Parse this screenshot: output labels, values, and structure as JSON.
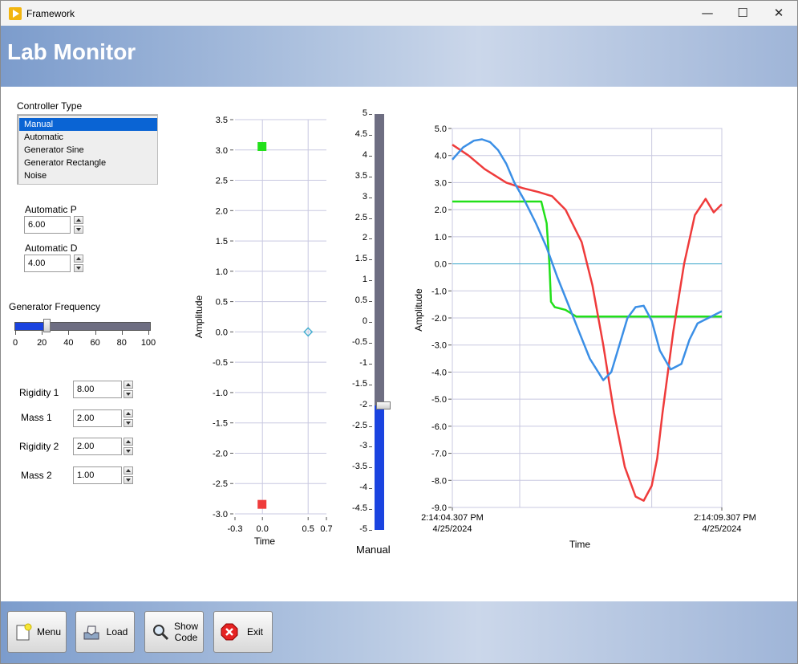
{
  "window": {
    "title": "Framework",
    "minimize": "—",
    "maximize": "☐",
    "close": "✕"
  },
  "header": {
    "title": "Lab Monitor"
  },
  "controller": {
    "label": "Controller Type",
    "items": [
      "Manual",
      "Automatic",
      "Generator Sine",
      "Generator Rectangle",
      "Noise"
    ],
    "selected": "Manual"
  },
  "automatic_p": {
    "label": "Automatic P",
    "value": "6.00"
  },
  "automatic_d": {
    "label": "Automatic D",
    "value": "4.00"
  },
  "generator_frequency": {
    "label": "Generator Frequency",
    "value": 23,
    "ticks": [
      "0",
      "20",
      "40",
      "60",
      "80",
      "100"
    ]
  },
  "rigidity_1": {
    "label": "Rigidity 1",
    "value": "8.00"
  },
  "mass_1": {
    "label": "Mass 1",
    "value": "2.00"
  },
  "rigidity_2": {
    "label": "Rigidity 2",
    "value": "2.00"
  },
  "mass_2": {
    "label": "Mass 2",
    "value": "1.00"
  },
  "manual_slider": {
    "label": "Manual",
    "value": -2,
    "ticks": [
      "5",
      "4.5",
      "4",
      "3.5",
      "3",
      "2.5",
      "2",
      "1.5",
      "1",
      "0.5",
      "0",
      "-0.5",
      "-1",
      "-1.5",
      "-2",
      "-2.5",
      "-3",
      "-3.5",
      "-4",
      "-4.5",
      "-5"
    ]
  },
  "buttons": {
    "menu": "Menu",
    "load": "Load",
    "show_code": "Show Code",
    "exit": "Exit"
  },
  "colors": {
    "green": "#22e01a",
    "red": "#ef3b3b",
    "blue": "#3b8fe6",
    "cyan": "#48b0d0",
    "slider_fill": "#1a43e0",
    "slider_track": "#6e6e82",
    "list_selected": "#0a64d4"
  },
  "chart_data": [
    {
      "type": "scatter",
      "xlabel": "Time",
      "ylabel": "Amplitude",
      "xlim": [
        -0.3,
        0.7
      ],
      "ylim": [
        -3,
        3.5
      ],
      "x_ticks": [
        "-0.3",
        "0.0",
        "0.5",
        "0.7"
      ],
      "y_ticks": [
        "3.5",
        "3.0",
        "2.5",
        "2.0",
        "1.5",
        "1.0",
        "0.5",
        "0.0",
        "-0.5",
        "-1.0",
        "-1.5",
        "-2.0",
        "-2.5",
        "-3.0"
      ],
      "points": [
        {
          "x": 0.0,
          "y": 3.05,
          "color": "#22e01a",
          "marker": "square"
        },
        {
          "x": 0.0,
          "y": -2.85,
          "color": "#ef3b3b",
          "marker": "square"
        },
        {
          "x": 0.5,
          "y": 0.0,
          "color": "#48b0d0",
          "marker": "diamond"
        }
      ]
    },
    {
      "type": "line",
      "xlabel": "Time",
      "ylabel": "Amplitude",
      "x_start_label": [
        "2:14:04.307 PM",
        "4/25/2024"
      ],
      "x_end_label": [
        "2:14:09.307 PM",
        "4/25/2024"
      ],
      "xlim": [
        0,
        5
      ],
      "ylim": [
        -9,
        5
      ],
      "y_ticks": [
        "5.0",
        "4.0",
        "3.0",
        "2.0",
        "1.0",
        "0.0",
        "-1.0",
        "-2.0",
        "-3.0",
        "-4.0",
        "-5.0",
        "-6.0",
        "-7.0",
        "-8.0",
        "-9.0"
      ],
      "reference_line": 0,
      "series": [
        {
          "color": "#22e01a",
          "x": [
            0,
            1.65,
            1.75,
            1.8,
            1.83,
            1.9,
            2.1,
            2.3,
            5
          ],
          "y": [
            2.3,
            2.3,
            1.5,
            0.0,
            -1.4,
            -1.6,
            -1.7,
            -1.95,
            -1.95
          ]
        },
        {
          "color": "#ef3b3b",
          "x": [
            0,
            0.3,
            0.6,
            1.0,
            1.3,
            1.6,
            1.85,
            2.1,
            2.4,
            2.6,
            2.8,
            3.0,
            3.2,
            3.4,
            3.55,
            3.7,
            3.8,
            3.9,
            4.1,
            4.3,
            4.5,
            4.7,
            4.85,
            5.0
          ],
          "y": [
            4.4,
            4.0,
            3.5,
            3.0,
            2.8,
            2.65,
            2.5,
            2.0,
            0.8,
            -0.8,
            -3.0,
            -5.5,
            -7.5,
            -8.6,
            -8.75,
            -8.2,
            -7.2,
            -5.5,
            -2.5,
            0.0,
            1.8,
            2.4,
            1.9,
            2.2
          ]
        },
        {
          "color": "#3b8fe6",
          "x": [
            0,
            0.2,
            0.4,
            0.55,
            0.7,
            0.85,
            1.0,
            1.15,
            1.35,
            1.55,
            1.75,
            1.95,
            2.15,
            2.35,
            2.55,
            2.8,
            2.95,
            3.1,
            3.25,
            3.4,
            3.55,
            3.7,
            3.85,
            4.05,
            4.25,
            4.4,
            4.55,
            4.75,
            5.0
          ],
          "y": [
            3.85,
            4.3,
            4.55,
            4.6,
            4.5,
            4.2,
            3.7,
            3.0,
            2.3,
            1.5,
            0.6,
            -0.5,
            -1.5,
            -2.5,
            -3.5,
            -4.3,
            -4.0,
            -3.0,
            -2.0,
            -1.6,
            -1.55,
            -2.1,
            -3.2,
            -3.9,
            -3.7,
            -2.8,
            -2.2,
            -2.0,
            -1.75
          ]
        }
      ]
    }
  ]
}
